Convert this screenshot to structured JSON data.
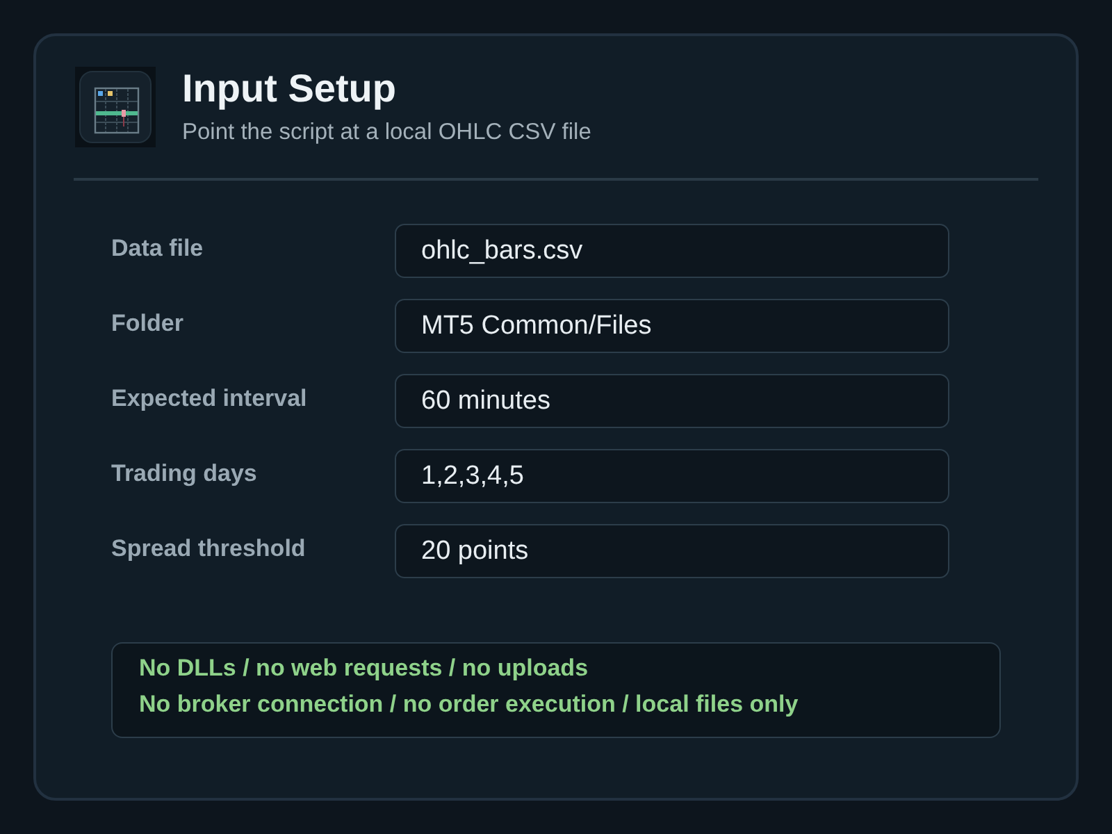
{
  "header": {
    "title": "Input Setup",
    "subtitle": "Point the script at a local OHLC CSV file"
  },
  "fields": [
    {
      "label": "Data file",
      "value": "ohlc_bars.csv"
    },
    {
      "label": "Folder",
      "value": "MT5 Common/Files"
    },
    {
      "label": "Expected interval",
      "value": "60 minutes"
    },
    {
      "label": "Trading days",
      "value": "1,2,3,4,5"
    },
    {
      "label": "Spread threshold",
      "value": "20 points"
    }
  ],
  "notice": {
    "lines": [
      "No DLLs / no web requests / no uploads",
      "No broker connection / no order execution / local files only"
    ]
  }
}
